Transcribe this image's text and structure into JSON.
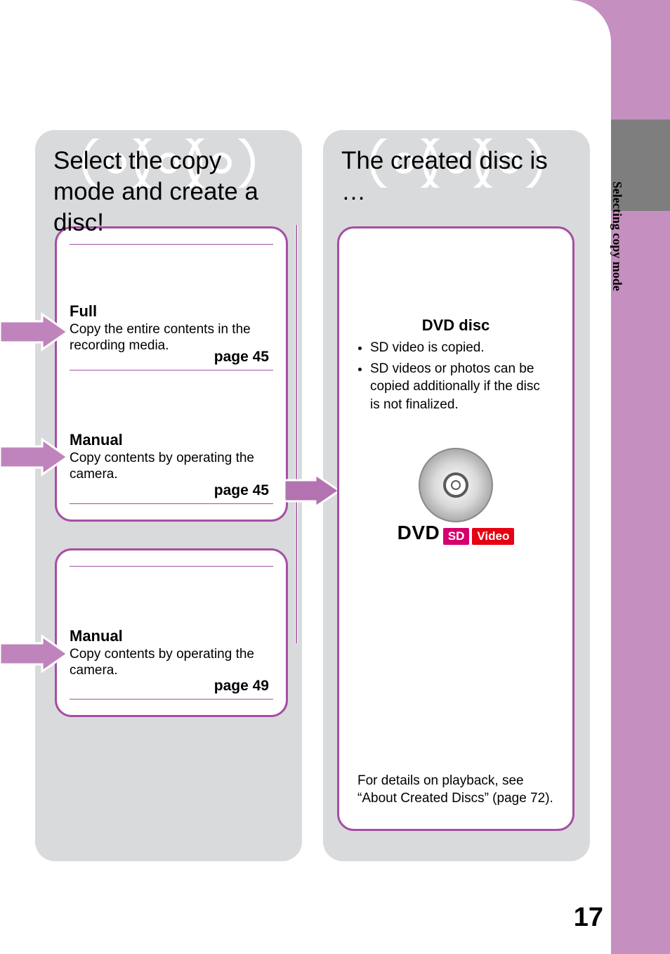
{
  "page_number": "17",
  "side_label": "Selecting copy mode",
  "left_panel": {
    "title": "Select the copy mode and create a disc!",
    "box1": {
      "items": [
        {
          "title": "Full",
          "desc": "Copy the entire contents in the recording media.",
          "page": "page 45"
        },
        {
          "title": "Manual",
          "desc": "Copy contents by operating the camera.",
          "page": "page 45"
        }
      ]
    },
    "box2": {
      "items": [
        {
          "title": "Manual",
          "desc": "Copy contents by operating the camera.",
          "page": "page 49"
        }
      ]
    }
  },
  "right_panel": {
    "title": "The created disc is …",
    "result": {
      "heading": "DVD disc",
      "bullets": [
        "SD video is copied.",
        "SD videos or photos can be copied additionally if the disc is not finalized."
      ],
      "disc_label": "DVD",
      "badges": {
        "sd": "SD",
        "video": "Video"
      },
      "footer": "For details on playback, see “About Created Discs” (page 72)."
    }
  }
}
